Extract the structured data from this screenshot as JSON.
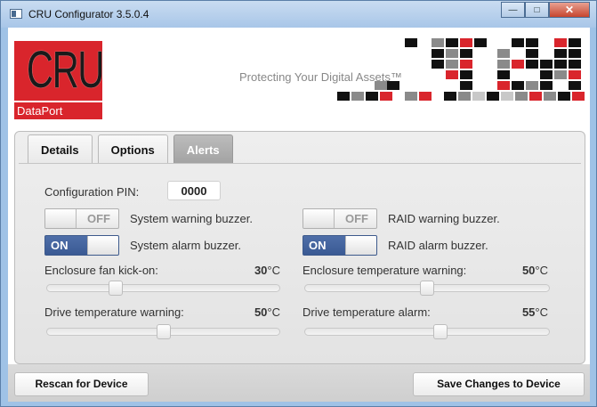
{
  "window": {
    "title": "CRU Configurator 3.5.0.4"
  },
  "header": {
    "logo_main": "CRU",
    "logo_sub": "DataPort",
    "tagline": "Protecting Your Digital Assets™"
  },
  "tabs": [
    {
      "label": "Details",
      "active": false
    },
    {
      "label": "Options",
      "active": false
    },
    {
      "label": "Alerts",
      "active": true
    }
  ],
  "alerts": {
    "pin_label": "Configuration PIN:",
    "pin_value": "0000",
    "toggles": [
      {
        "state": "OFF",
        "label": "System warning buzzer."
      },
      {
        "state": "ON",
        "label": "System alarm buzzer."
      },
      {
        "state": "OFF",
        "label": "RAID warning buzzer."
      },
      {
        "state": "ON",
        "label": "RAID alarm buzzer."
      }
    ],
    "sliders": [
      {
        "label": "Enclosure fan kick-on:",
        "value": "30",
        "unit": "°C",
        "level": 0.28
      },
      {
        "label": "Enclosure temperature warning:",
        "value": "50",
        "unit": "°C",
        "level": 0.5
      },
      {
        "label": "Drive temperature warning:",
        "value": "50",
        "unit": "°C",
        "level": 0.5
      },
      {
        "label": "Drive temperature alarm:",
        "value": "55",
        "unit": "°C",
        "level": 0.56
      }
    ]
  },
  "buttons": {
    "rescan": "Rescan for Device",
    "save": "Save Changes to Device"
  },
  "colors": {
    "brand_red": "#d9252c",
    "toggle_on": "#3f5f99",
    "window_frame": "#9fc2e6"
  }
}
